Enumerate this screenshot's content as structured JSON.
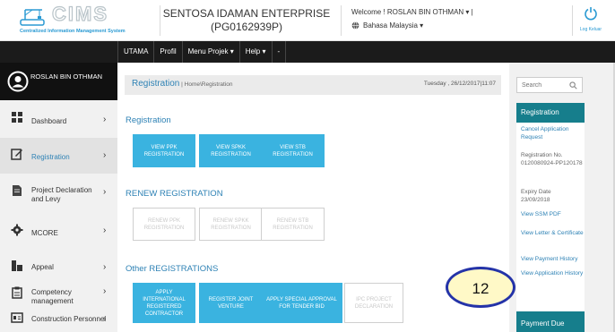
{
  "header": {
    "logo_title": "CIMS",
    "logo_subtitle": "Centralized Information Management System",
    "company_name": "SENTOSA IDAMAN ENTERPRISE",
    "company_id": "(PG0162939P)",
    "welcome": "Welcome ! ROSLAN BIN OTHMAN ▾ |",
    "language": "Bahasa Malaysia ▾",
    "logout_label": "Log Keluar",
    "icons": {
      "logo": "crane-logo-icon",
      "language": "globe-icon",
      "logout": "power-icon"
    }
  },
  "nav": {
    "items": [
      {
        "label": "UTAMA"
      },
      {
        "label": "Profil"
      },
      {
        "label": "Menu Projek ▾"
      },
      {
        "label": "Help ▾"
      },
      {
        "label": "-"
      }
    ]
  },
  "sidebar": {
    "user_name": "ROSLAN BIN OTHMAN",
    "items": [
      {
        "label": "Dashboard",
        "icon": "dashboard-icon",
        "chevron": "›"
      },
      {
        "label": "Registration",
        "icon": "edit-icon",
        "chevron": "›"
      },
      {
        "label": "Project Declaration and Levy",
        "icon": "document-icon",
        "chevron": "›"
      },
      {
        "label": "MCORE",
        "icon": "gear-icon",
        "chevron": "›"
      },
      {
        "label": "Appeal",
        "icon": "appeal-icon",
        "chevron": "›"
      },
      {
        "label": "Competency management",
        "icon": "clipboard-icon",
        "chevron": "›"
      },
      {
        "label": "Construction Personnel",
        "icon": "id-card-icon",
        "chevron": "›"
      }
    ]
  },
  "content": {
    "page_title": "Registration",
    "breadcrumb": " | Home\\Registration",
    "date": "Tuesday , 26/12/2017|11:07",
    "sections": [
      {
        "title": "Registration",
        "tiles": [
          {
            "label": "VIEW PPK REGISTRATION",
            "disabled": false
          },
          {
            "label": "VIEW SPKK REGISTRATION",
            "disabled": false
          },
          {
            "label": "VIEW STB REGISTRATION",
            "disabled": false
          }
        ]
      },
      {
        "title": "RENEW REGISTRATION",
        "tiles": [
          {
            "label": "RENEW PPK REGISTRATION",
            "disabled": true
          },
          {
            "label": "RENEW SPKK REGISTRATION",
            "disabled": true
          },
          {
            "label": "RENEW STB REGISTRATION",
            "disabled": true
          }
        ]
      },
      {
        "title": "Other REGISTRATIONS",
        "tiles": [
          {
            "label": "APPLY INTERNATIONAL REGISTERED CONTRACTOR",
            "disabled": false
          },
          {
            "label": "REGISTER JOINT VENTURE",
            "disabled": false
          },
          {
            "label": "APPLY SPECIAL APPROVAL FOR TENDER BID",
            "disabled": false
          },
          {
            "label": "IPC PROJECT DECLARATION",
            "disabled": true
          }
        ]
      }
    ]
  },
  "right_panel": {
    "search_placeholder": "Search",
    "registration_title": "Registration",
    "cancel_request": "Cancel Application Request",
    "reg_no_label": "Registration No.",
    "reg_no_value": "0120080924-PP120178",
    "expiry_label": "Expiry Date",
    "expiry_value": "23/09/2018",
    "view_ssm": "View SSM PDF",
    "view_letter": "View Letter & Certificate",
    "view_payment": "View Payment History",
    "view_application": "View Application History",
    "payment_due": "Payment Due"
  },
  "annotation": {
    "number": "12"
  },
  "colors": {
    "accent": "#3ab3e0",
    "panel_header": "#167e8c",
    "nav_bg": "#1b1b1b",
    "link": "#2e82b5",
    "callout_fill": "#fff9c7",
    "callout_border": "#2433a8"
  }
}
